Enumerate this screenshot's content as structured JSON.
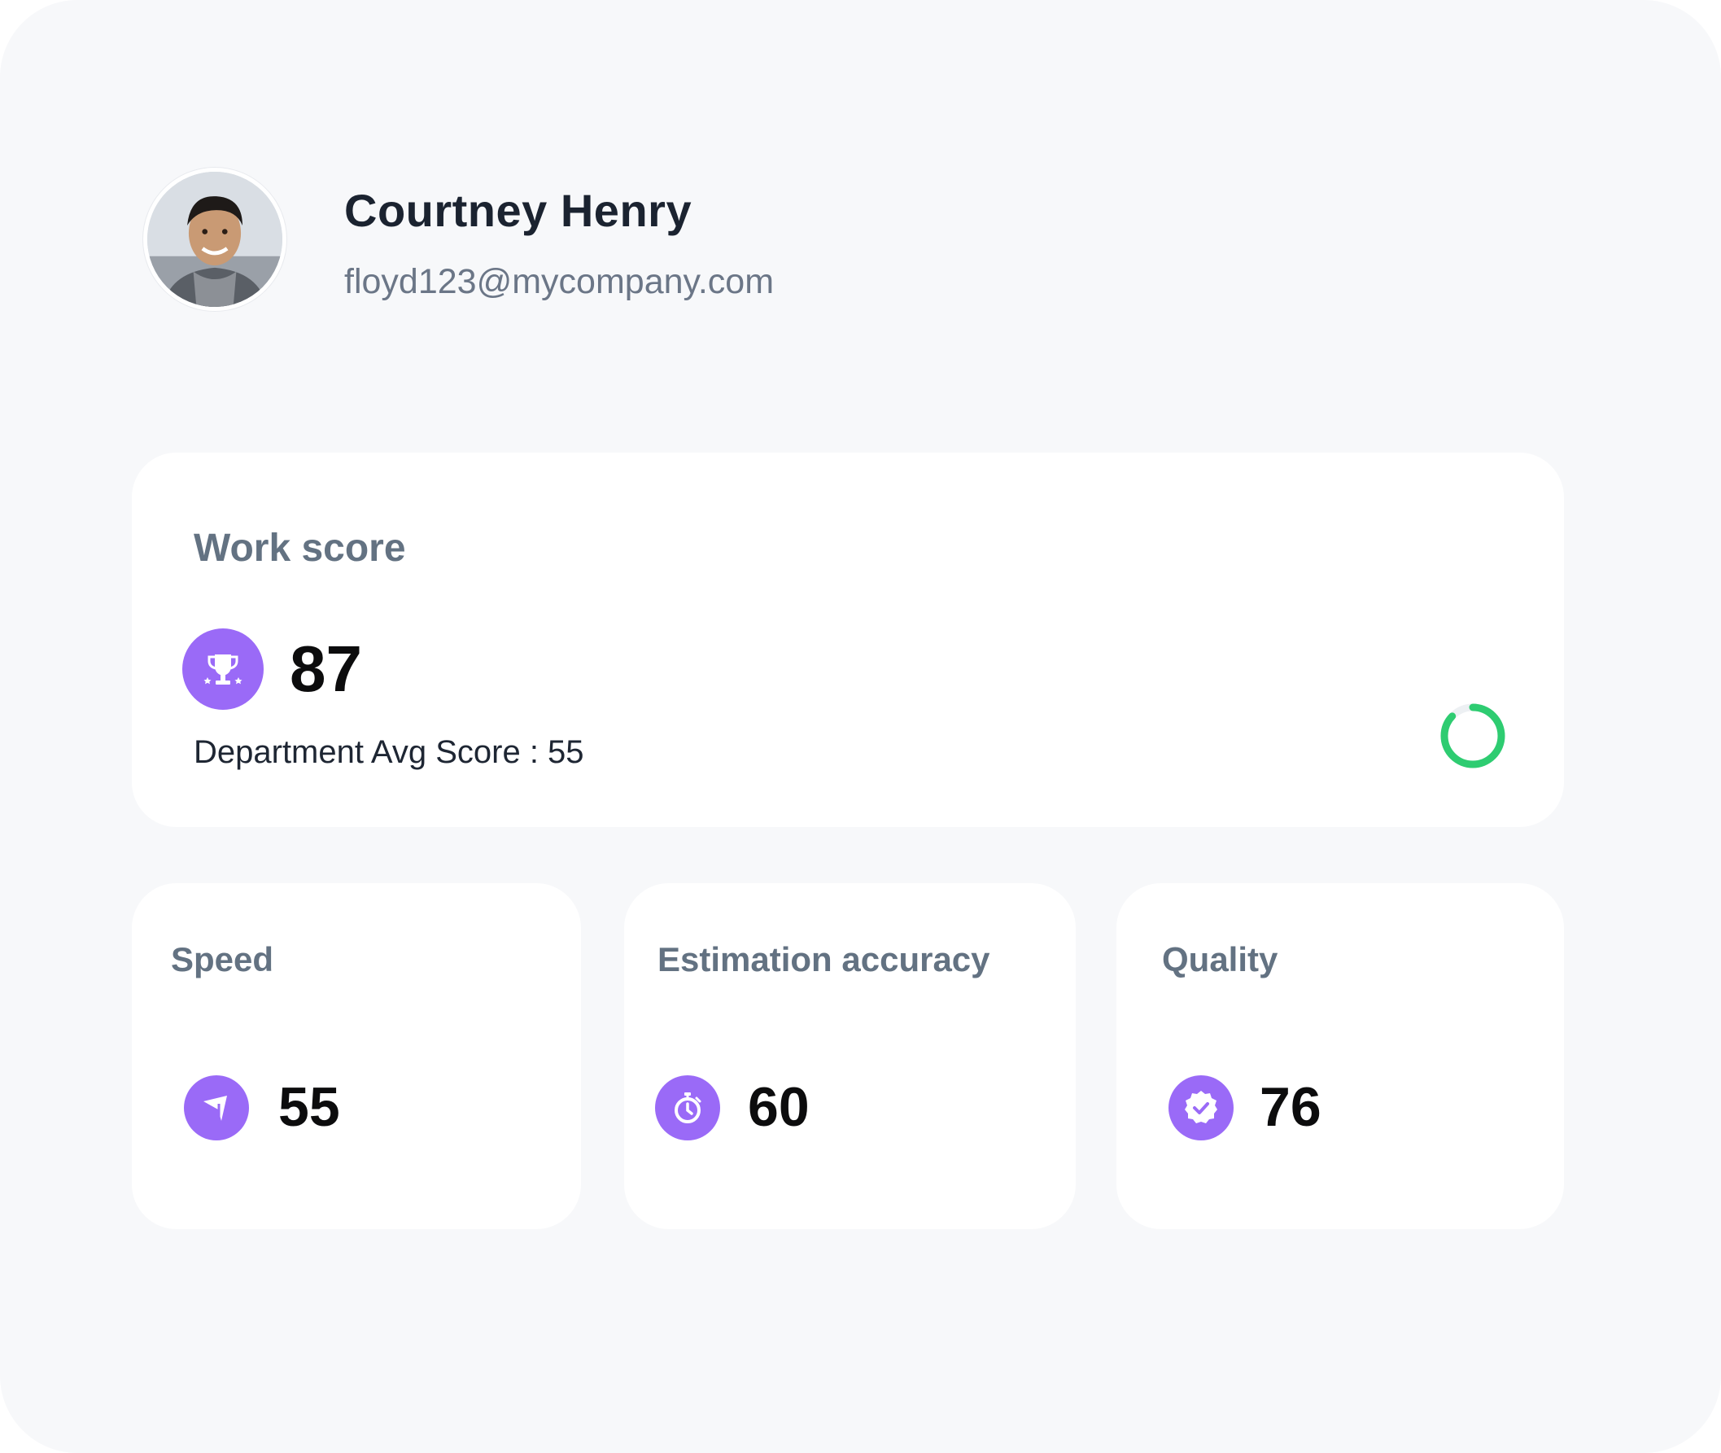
{
  "profile": {
    "name": "Courtney Henry",
    "email": "floyd123@mycompany.com"
  },
  "work_score": {
    "title": "Work score",
    "value": "87",
    "department_avg_text": "Department Avg Score : 55",
    "icon": "trophy-icon",
    "progress_fraction": 0.87,
    "ring_color": "#2ecc71"
  },
  "metrics": [
    {
      "title": "Speed",
      "value": "55",
      "icon": "speed-arrow-icon"
    },
    {
      "title": "Estimation accuracy",
      "value": "60",
      "icon": "stopwatch-icon"
    },
    {
      "title": "Quality",
      "value": "76",
      "icon": "verified-badge-icon"
    }
  ],
  "colors": {
    "accent": "#9a6af7",
    "background": "#f7f8fa",
    "card": "#ffffff",
    "heading": "#637282",
    "success": "#2ecc71"
  }
}
